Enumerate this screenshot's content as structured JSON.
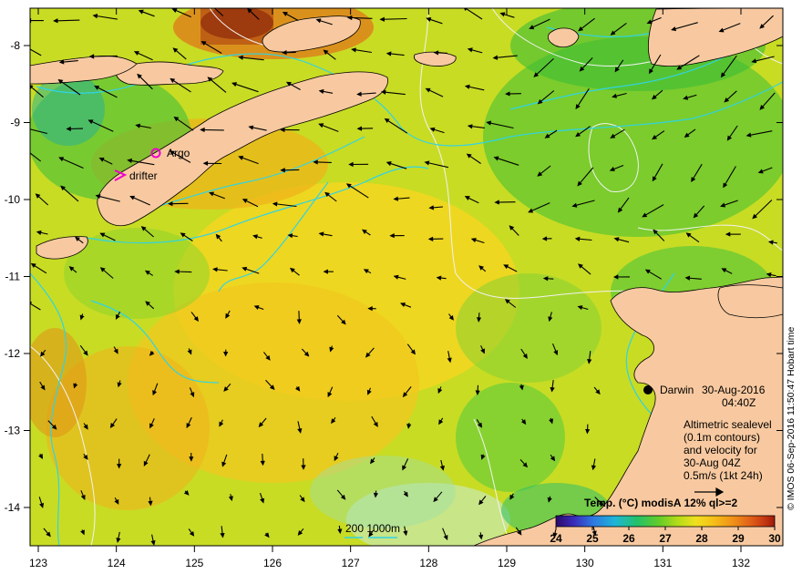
{
  "map": {
    "lon_ticks": [
      "123",
      "124",
      "125",
      "126",
      "127",
      "128",
      "129",
      "130",
      "131",
      "132"
    ],
    "lat_ticks": [
      "-8",
      "-9",
      "-10",
      "-11",
      "-12",
      "-13",
      "-14"
    ],
    "markers": {
      "argo_label": "Argo",
      "drifter_label": "drifter",
      "city_label": "Darwin"
    },
    "info": {
      "date": "30-Aug-2016",
      "time": "04:40Z",
      "line1": "Altimetric sealevel",
      "line2": "(0.1m contours)",
      "line3": "and velocity for",
      "line4": "30-Aug 04Z",
      "line5": "0.5m/s (1kt 24h)"
    },
    "depth_legend": "200  1000m",
    "colorbar": {
      "title": "Temp. (°C) modisA 12% ql>=2",
      "ticks": [
        "24",
        "25",
        "26",
        "27",
        "28",
        "29",
        "30"
      ],
      "colors": [
        "#2a0a6a",
        "#3a2ab8",
        "#2e78e0",
        "#1fb6d8",
        "#23c16a",
        "#63cc2a",
        "#b6dc18",
        "#f0e020",
        "#f5c018",
        "#f09018",
        "#e06018",
        "#c83a12",
        "#9e1a0a"
      ]
    },
    "credit": "© IMOS 06-Sep-2016 11:50:47 Hobart time",
    "colors": {
      "land": "#f8c9a0",
      "contour": "#30d4e4",
      "sealevel": "#f2f2f2",
      "argo": "#ee00cc"
    }
  }
}
